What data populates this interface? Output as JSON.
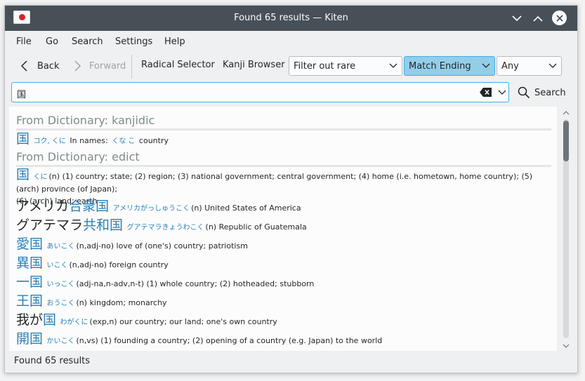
{
  "window": {
    "title": "Found 65 results — Kiten",
    "app_icon": "japan-flag-icon"
  },
  "menu": [
    "File",
    "Go",
    "Search",
    "Settings",
    "Help"
  ],
  "toolbar": {
    "back_label": "Back",
    "forward_label": "Forward",
    "radical_selector_label": "Radical Selector",
    "kanji_browser_label": "Kanji Browser",
    "filter_value": "Filter out rare",
    "match_value": "Match Ending",
    "type_value": "Any"
  },
  "search": {
    "value": "国",
    "button_label": "Search"
  },
  "results": {
    "section_kanjidic": "From Dictionary: kanjidic",
    "kanjidic_entry": {
      "kanji": "国",
      "reading": "コク, くに",
      "names_prefix": "In names:",
      "names_reading": "くな こ",
      "meaning": "country"
    },
    "section_edict": "From Dictionary: edict",
    "edict_entries": [
      {
        "word_a": "",
        "word_b": "国",
        "reading": "くに",
        "meaning": "(n) (1) country; state; (2) region; (3) national government; central government; (4) home (i.e. hometown, home country); (5) (arch) province (of Japan);",
        "meaning2": "(6) (arch) land; earth"
      },
      {
        "word_a": "アメリカ",
        "word_b": "合衆国",
        "reading": "アメリカがっしゅうこく",
        "meaning": "(n) United States of America",
        "meaning2": ""
      },
      {
        "word_a": "グアテマラ",
        "word_b": "共和国",
        "reading": "グアテマラきょうわこく",
        "meaning": "(n) Republic of Guatemala",
        "meaning2": ""
      },
      {
        "word_a": "",
        "word_b": "愛国",
        "reading": "あいこく",
        "meaning": "(n,adj-no) love of (one's) country; patriotism",
        "meaning2": ""
      },
      {
        "word_a": "",
        "word_b": "異国",
        "reading": "いこく",
        "meaning": "(n,adj-no) foreign country",
        "meaning2": ""
      },
      {
        "word_a": "",
        "word_b": "一国",
        "reading": "いっこく",
        "meaning": "(adj-na,n-adv,n-t) (1) whole country; (2) hotheaded; stubborn",
        "meaning2": ""
      },
      {
        "word_a": "",
        "word_b": "王国",
        "reading": "おうこく",
        "meaning": "(n) kingdom; monarchy",
        "meaning2": ""
      },
      {
        "word_a": "我が",
        "word_b": "国",
        "reading": "わがくに",
        "meaning": "(exp,n) our country; our land; one's own country",
        "meaning2": ""
      },
      {
        "word_a": "",
        "word_b": "開国",
        "reading": "かいこく",
        "meaning": "(n,vs) (1) founding a country; (2) opening of a country (e.g. Japan) to the world",
        "meaning2": ""
      }
    ]
  },
  "status": {
    "text": "Found 65 results"
  }
}
